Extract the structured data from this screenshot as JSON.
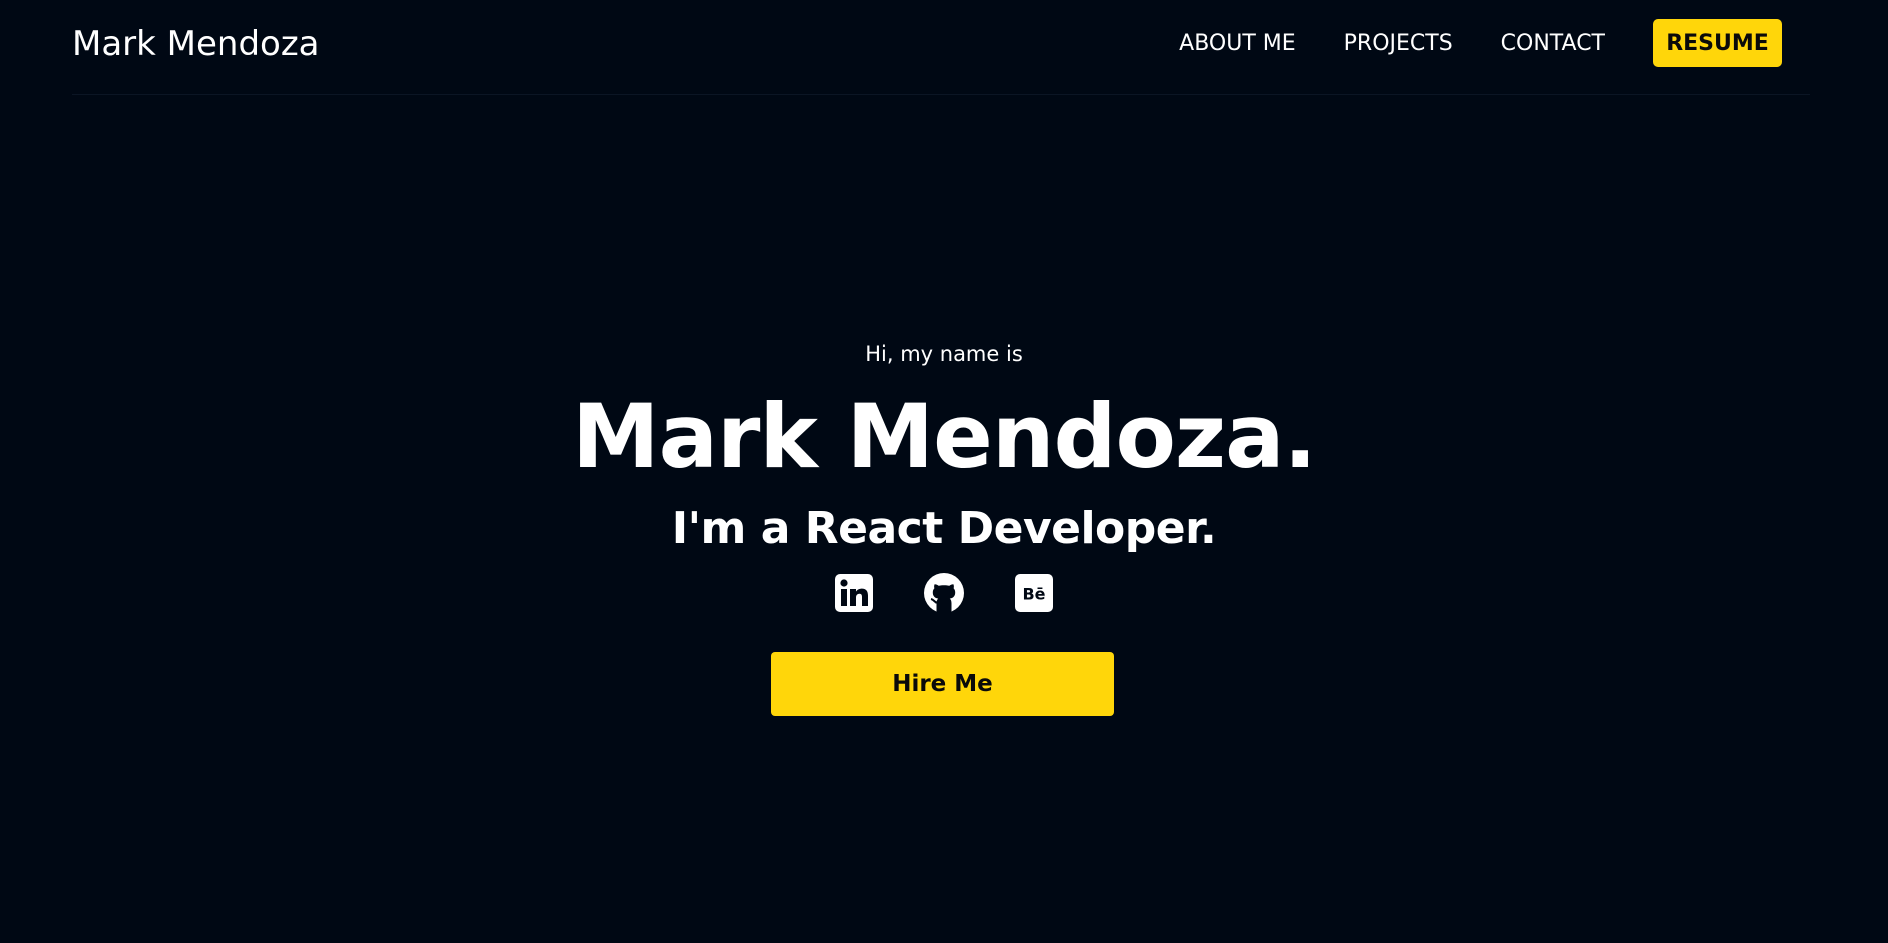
{
  "header": {
    "brand": "Mark Mendoza",
    "nav": {
      "about": "ABOUT ME",
      "projects": "PROJECTS",
      "contact": "CONTACT"
    },
    "resume_label": "RESUME"
  },
  "hero": {
    "greeting": "Hi, my name is",
    "name": "Mark Mendoza.",
    "role": "I'm a React Developer.",
    "socials": [
      {
        "icon": "linkedin-icon"
      },
      {
        "icon": "github-icon"
      },
      {
        "icon": "behance-icon"
      }
    ],
    "cta_label": "Hire Me"
  },
  "colors": {
    "background": "#000814",
    "accent": "#ffd60a",
    "text": "#ffffff"
  }
}
